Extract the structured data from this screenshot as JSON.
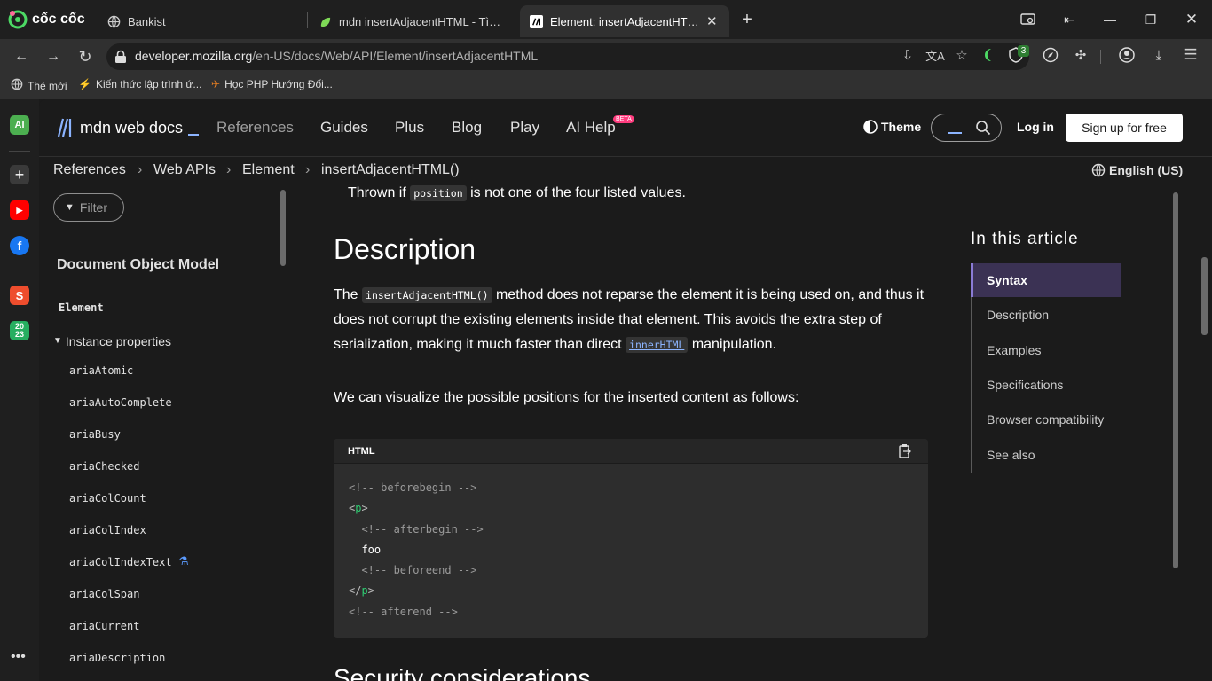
{
  "browser": {
    "brand": "cốc cốc",
    "tabs": [
      {
        "label": "Bankist",
        "icon": "globe-icon",
        "active": false
      },
      {
        "label": "mdn insertAdjacentHTML - Tìm với Google",
        "icon": "search-leaf-icon",
        "active": false
      },
      {
        "label": "Element: insertAdjacentHTML() method",
        "icon": "mdn-logo-icon",
        "active": true
      }
    ],
    "url_host": "developer.mozilla.org",
    "url_path": "/en-US/docs/Web/API/Element/insertAdjacentHTML",
    "extension_badge": "3",
    "bookmarks": [
      {
        "label": "Thẻ mới",
        "icon": "globe-icon"
      },
      {
        "label": "Kiến thức lập trình ứ...",
        "icon": "folder-icon"
      },
      {
        "label": "Học PHP Hướng Đối...",
        "icon": "bird-icon"
      }
    ],
    "rail_badges": {
      "ai": "AI",
      "year": "20 23"
    }
  },
  "mdn": {
    "logo_text": "mdn web docs",
    "nav": {
      "references": "References",
      "guides": "Guides",
      "plus": "Plus",
      "blog": "Blog",
      "play": "Play",
      "ai_help": "AI Help",
      "beta": "BETA"
    },
    "theme_label": "Theme",
    "login_label": "Log in",
    "signup_label": "Sign up for free",
    "breadcrumbs": [
      "References",
      "Web APIs",
      "Element",
      "insertAdjacentHTML()"
    ],
    "language": "English (US)",
    "filter_placeholder": "Filter",
    "sidebar": {
      "heading": "Document Object Model",
      "element": "Element",
      "group": "Instance properties",
      "items": [
        "ariaAtomic",
        "ariaAutoComplete",
        "ariaBusy",
        "ariaChecked",
        "ariaColCount",
        "ariaColIndex",
        "ariaColIndexText",
        "ariaColSpan",
        "ariaCurrent",
        "ariaDescription"
      ]
    },
    "content": {
      "thrown_pre": "Thrown if",
      "thrown_code": "position",
      "thrown_post": "is not one of the four listed values.",
      "description_heading": "Description",
      "para1_a": "The",
      "para1_code": "insertAdjacentHTML()",
      "para1_b": "method does not reparse the element it is being used on, and thus it does not corrupt the existing elements inside that element. This avoids the extra step of serialization, making it much faster than direct",
      "para1_link": "innerHTML",
      "para1_c": "manipulation.",
      "para2": "We can visualize the possible positions for the inserted content as follows:",
      "code_lang": "HTML",
      "code": {
        "l1": "<!-- beforebegin -->",
        "l2_open": "<",
        "l2_tag": "p",
        "l2_close": ">",
        "l3": "  <!-- afterbegin -->",
        "l4": "  foo",
        "l5": "  <!-- beforeend -->",
        "l6_open": "</",
        "l6_tag": "p",
        "l6_close": ">",
        "l7": "<!-- afterend -->"
      },
      "next_heading": "Security considerations"
    },
    "toc": {
      "heading": "In this article",
      "items": [
        "Syntax",
        "Description",
        "Examples",
        "Specifications",
        "Browser compatibility",
        "See also"
      ]
    }
  },
  "colors": {
    "accent": "#8a7bd6",
    "link": "#8cb4ff",
    "toc_active_bg": "#3b3254",
    "tag_green": "#2ecc71"
  }
}
